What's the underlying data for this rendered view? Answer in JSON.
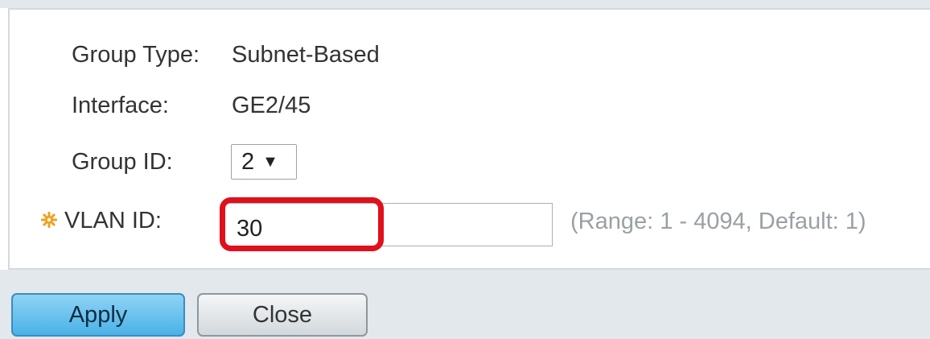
{
  "form": {
    "group_type": {
      "label": "Group Type:",
      "value": "Subnet-Based"
    },
    "interface": {
      "label": "Interface:",
      "value": "GE2/45"
    },
    "group_id": {
      "label": "Group ID:",
      "selected": "2"
    },
    "vlan_id": {
      "label": "VLAN ID:",
      "value": "30",
      "hint": "(Range: 1 - 4094, Default: 1)"
    }
  },
  "buttons": {
    "apply_label": "Apply",
    "close_label": "Close"
  },
  "colors": {
    "required_icon": "#f0a020",
    "highlight": "#e0101c",
    "apply_button": "#4ab2e6"
  },
  "icons": {
    "required": "required-asterisk-icon",
    "dropdown": "chevron-down-icon"
  }
}
